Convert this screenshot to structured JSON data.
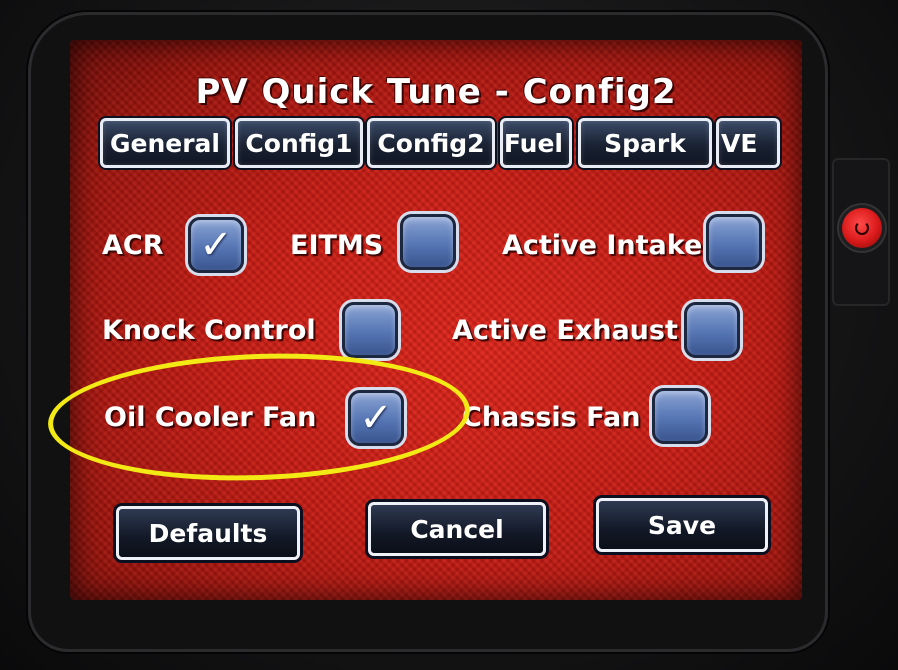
{
  "window": {
    "title": "PV Quick Tune - Config2"
  },
  "tabs": [
    {
      "label": "General"
    },
    {
      "label": "Config1"
    },
    {
      "label": "Config2",
      "selected": true
    },
    {
      "label": "Fuel"
    },
    {
      "label": "Spark"
    },
    {
      "label": "VE"
    }
  ],
  "options": {
    "acr": {
      "label": "ACR",
      "checked": true
    },
    "eitms": {
      "label": "EITMS",
      "checked": false
    },
    "active_intake": {
      "label": "Active Intake",
      "checked": false
    },
    "knock_control": {
      "label": "Knock Control",
      "checked": false
    },
    "active_exhaust": {
      "label": "Active Exhaust",
      "checked": false
    },
    "oil_cooler_fan": {
      "label": "Oil Cooler Fan",
      "checked": true
    },
    "chassis_fan": {
      "label": "Chassis Fan",
      "checked": false
    }
  },
  "buttons": {
    "defaults": "Defaults",
    "cancel": "Cancel",
    "save": "Save"
  },
  "check_glyph": "✓",
  "colors": {
    "screen_red": "#c81d14",
    "checkbox_blue": "#5575b3",
    "button_dark": "#121826",
    "highlight_yellow": "#f3ea15"
  }
}
